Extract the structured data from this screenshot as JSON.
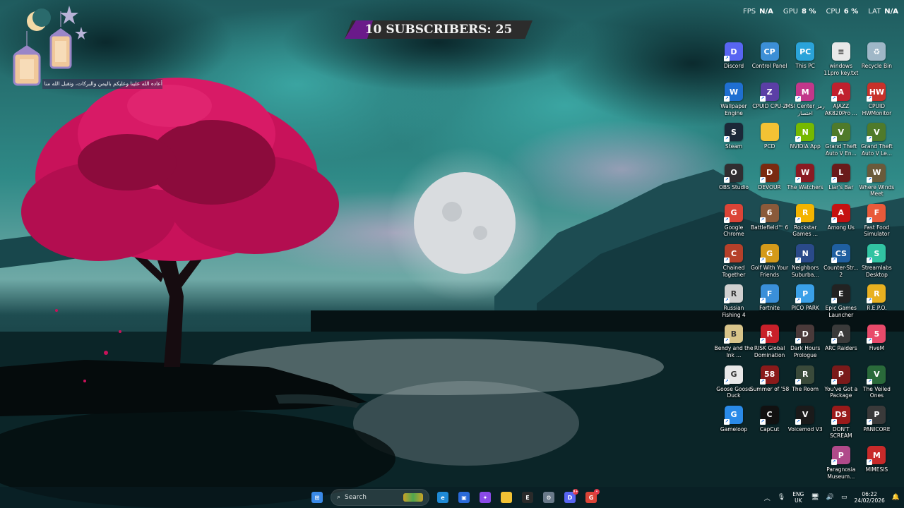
{
  "overlay": {
    "ramadan_text": "أعاده الله علينا وعليكم باليمن والبركات، وتقبل الله منا ومنكم"
  },
  "subscribers": {
    "count_left": "10",
    "label": "SUBSCRIBERS:",
    "count_right": "25"
  },
  "perf": [
    {
      "label": "FPS",
      "value": "N/A"
    },
    {
      "label": "GPU",
      "value": "8 %"
    },
    {
      "label": "CPU",
      "value": "6 %"
    },
    {
      "label": "LAT",
      "value": "N/A"
    }
  ],
  "desktop_icons": [
    {
      "label": "Discord",
      "icon": "discord-icon",
      "color": "#5865f2",
      "glyph": "D"
    },
    {
      "label": "Control Panel",
      "icon": "control-panel-icon",
      "color": "#3c8fd6",
      "glyph": "CP"
    },
    {
      "label": "This PC",
      "icon": "this-pc-icon",
      "color": "#2aa3d9",
      "glyph": "PC"
    },
    {
      "label": "windows 11pro key.txt",
      "icon": "text-file-icon",
      "color": "#e8e8e8",
      "glyph": "≡"
    },
    {
      "label": "Recycle Bin",
      "icon": "recycle-bin-icon",
      "color": "#9fb7c7",
      "glyph": "♻"
    },
    {
      "label": "Wallpaper Engine",
      "icon": "wallpaper-engine-icon",
      "color": "#1f6fd1",
      "glyph": "W"
    },
    {
      "label": "CPUID CPU-Z",
      "icon": "cpu-z-icon",
      "color": "#5b3fa6",
      "glyph": "Z"
    },
    {
      "label": "MSI Center رمز اختصار",
      "icon": "msi-center-icon",
      "color": "#c2378a",
      "glyph": "M"
    },
    {
      "label": "AJAZZ AK820Pro ...",
      "icon": "ajazz-icon",
      "color": "#c0202e",
      "glyph": "A"
    },
    {
      "label": "CPUID HWMonitor",
      "icon": "hwmonitor-icon",
      "color": "#c8312a",
      "glyph": "HW"
    },
    {
      "label": "Steam",
      "icon": "steam-icon",
      "color": "#1b2838",
      "glyph": "S"
    },
    {
      "label": "PCD",
      "icon": "folder-icon",
      "color": "#f3c234",
      "glyph": ""
    },
    {
      "label": "NVIDIA App",
      "icon": "nvidia-icon",
      "color": "#76b900",
      "glyph": "N"
    },
    {
      "label": "Grand Theft Auto V En...",
      "icon": "gta-v-icon",
      "color": "#4f7a2a",
      "glyph": "V"
    },
    {
      "label": "Grand Theft Auto V Le...",
      "icon": "gta-v-legacy-icon",
      "color": "#4f7a2a",
      "glyph": "V"
    },
    {
      "label": "OBS Studio",
      "icon": "obs-icon",
      "color": "#302e31",
      "glyph": "O"
    },
    {
      "label": "DEVOUR",
      "icon": "devour-icon",
      "color": "#7a2a10",
      "glyph": "D"
    },
    {
      "label": "The Watchers",
      "icon": "watchers-icon",
      "color": "#8a1a22",
      "glyph": "W"
    },
    {
      "label": "Liar's Bar",
      "icon": "liars-bar-icon",
      "color": "#6a1a1a",
      "glyph": "L"
    },
    {
      "label": "Where Winds Meet",
      "icon": "where-winds-meet-icon",
      "color": "#6a5a3a",
      "glyph": "W"
    },
    {
      "label": "Google Chrome",
      "icon": "chrome-icon",
      "color": "#db4437",
      "glyph": "G"
    },
    {
      "label": "Battlefield™ 6",
      "icon": "battlefield-icon",
      "color": "#8a5a3a",
      "glyph": "6"
    },
    {
      "label": "Rockstar Games ...",
      "icon": "rockstar-icon",
      "color": "#f4b400",
      "glyph": "R"
    },
    {
      "label": "Among Us",
      "icon": "among-us-icon",
      "color": "#c51111",
      "glyph": "A"
    },
    {
      "label": "Fast Food Simulator",
      "icon": "fast-food-icon",
      "color": "#e85a3a",
      "glyph": "F"
    },
    {
      "label": "Chained Together",
      "icon": "chained-together-icon",
      "color": "#b5402a",
      "glyph": "C"
    },
    {
      "label": "Golf With Your Friends",
      "icon": "golf-icon",
      "color": "#d49a1a",
      "glyph": "G"
    },
    {
      "label": "Neighbors Suburba...",
      "icon": "neighbors-icon",
      "color": "#2a4a8a",
      "glyph": "N"
    },
    {
      "label": "Counter-Str... 2",
      "icon": "cs2-icon",
      "color": "#1f5fa0",
      "glyph": "CS"
    },
    {
      "label": "Streamlabs Desktop",
      "icon": "streamlabs-icon",
      "color": "#31c3a2",
      "glyph": "S"
    },
    {
      "label": "Russian Fishing 4",
      "icon": "russian-fishing-icon",
      "color": "#d0d0d0",
      "glyph": "R"
    },
    {
      "label": "Fortnite",
      "icon": "fortnite-icon",
      "color": "#3a8fd9",
      "glyph": "F"
    },
    {
      "label": "PICO PARK",
      "icon": "pico-park-icon",
      "color": "#3aa0e8",
      "glyph": "P"
    },
    {
      "label": "Epic Games Launcher",
      "icon": "epic-games-icon",
      "color": "#222222",
      "glyph": "E"
    },
    {
      "label": "R.E.P.O.",
      "icon": "repo-icon",
      "color": "#e8b020",
      "glyph": "R"
    },
    {
      "label": "Bendy and the Ink ...",
      "icon": "bendy-icon",
      "color": "#d8c48a",
      "glyph": "B"
    },
    {
      "label": "RISK Global Domination",
      "icon": "risk-icon",
      "color": "#c8202a",
      "glyph": "R"
    },
    {
      "label": "Dark Hours Prologue",
      "icon": "dark-hours-icon",
      "color": "#4a3a3a",
      "glyph": "D"
    },
    {
      "label": "ARC Raiders",
      "icon": "arc-raiders-icon",
      "color": "#3a3a3a",
      "glyph": "A"
    },
    {
      "label": "FiveM",
      "icon": "fivem-icon",
      "color": "#e84a6a",
      "glyph": "5"
    },
    {
      "label": "Goose Goose Duck",
      "icon": "goose-goose-duck-icon",
      "color": "#e8e8e8",
      "glyph": "G"
    },
    {
      "label": "Summer of '58",
      "icon": "summer-58-icon",
      "color": "#8a1a1a",
      "glyph": "58"
    },
    {
      "label": "The Room",
      "icon": "the-room-icon",
      "color": "#3a4a3a",
      "glyph": "R"
    },
    {
      "label": "You've Got a Package",
      "icon": "package-icon",
      "color": "#7a1a1a",
      "glyph": "P"
    },
    {
      "label": "The Veiled Ones",
      "icon": "veiled-ones-icon",
      "color": "#2a6a3a",
      "glyph": "V"
    },
    {
      "label": "Gameloop",
      "icon": "gameloop-icon",
      "color": "#2a8ae8",
      "glyph": "G"
    },
    {
      "label": "CapCut",
      "icon": "capcut-icon",
      "color": "#111111",
      "glyph": "C"
    },
    {
      "label": "Voicemod V3",
      "icon": "voicemod-icon",
      "color": "#1a1a1a",
      "glyph": "V"
    },
    {
      "label": "DON'T SCREAM",
      "icon": "dont-scream-icon",
      "color": "#9a1a1a",
      "glyph": "DS"
    },
    {
      "label": "PANICORE",
      "icon": "panicore-icon",
      "color": "#3a3a3a",
      "glyph": "P"
    },
    {
      "label": "Paragnosia Museum...",
      "icon": "paragnosia-icon",
      "color": "#b04a8a",
      "glyph": "P"
    },
    {
      "label": "MIMESIS",
      "icon": "mimesis-icon",
      "color": "#c82a2a",
      "glyph": "M"
    }
  ],
  "taskbar": {
    "search_placeholder": "Search",
    "apps": [
      {
        "name": "start-button",
        "icon": "windows-start-icon",
        "color": "#3a8ae8",
        "glyph": "⊞"
      },
      {
        "name": "edge-button",
        "icon": "edge-icon",
        "color": "#1f8ad6",
        "glyph": "e"
      },
      {
        "name": "store-button",
        "icon": "store-icon",
        "color": "#2a6ad9",
        "glyph": "▣"
      },
      {
        "name": "copilot-button",
        "icon": "copilot-icon",
        "color": "#8a4ae8",
        "glyph": "✦"
      },
      {
        "name": "file-explorer-button",
        "icon": "folder-icon",
        "color": "#f3c234",
        "glyph": ""
      },
      {
        "name": "epic-button",
        "icon": "epic-games-icon",
        "color": "#2a2a2a",
        "glyph": "E"
      },
      {
        "name": "settings-button",
        "icon": "gear-icon",
        "color": "#6a7a8a",
        "glyph": "⚙"
      },
      {
        "name": "discord-button",
        "icon": "discord-icon",
        "color": "#5865f2",
        "glyph": "D",
        "badge": "9+"
      },
      {
        "name": "chrome-button",
        "icon": "chrome-icon",
        "color": "#db4437",
        "glyph": "G",
        "badge": "•"
      }
    ],
    "tray": {
      "lang_line1": "ENG",
      "lang_line2": "UK",
      "time": "06:22",
      "date": "24/02/2026"
    }
  }
}
